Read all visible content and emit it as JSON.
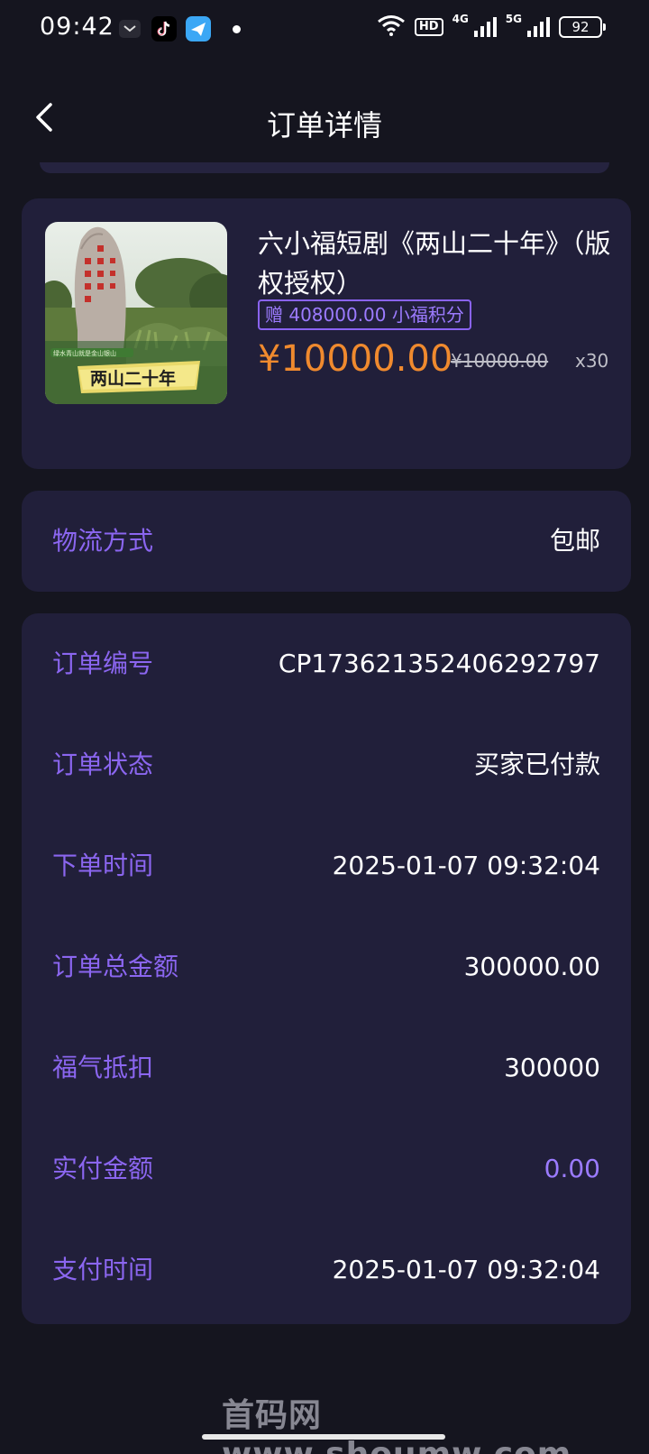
{
  "status_bar": {
    "time": "09:42",
    "hd_label": "HD",
    "net_4g": "4G",
    "net_5g": "5G",
    "battery": "92"
  },
  "header": {
    "title": "订单详情"
  },
  "product": {
    "title": "六小福短剧《两山二十年》（版权授权）",
    "gift": "赠 408000.00 小福积分",
    "price": "¥10000.00",
    "original_price": "¥10000.00",
    "quantity": "x30",
    "thumb_caption": "两山二十年",
    "thumb_engraving": "绿水青山就是金山银山"
  },
  "shipping": {
    "label": "物流方式",
    "value": "包邮"
  },
  "order_info": {
    "rows": [
      {
        "label": "订单编号",
        "value": "CP1736213524062927​97"
      },
      {
        "label": "订单状态",
        "value": "买家已付款"
      },
      {
        "label": "下单时间",
        "value": "2025-01-07 09:32:04"
      },
      {
        "label": "订单总金额",
        "value": "300000.00"
      },
      {
        "label": "福气抵扣",
        "value": "300000"
      },
      {
        "label": "实付金额",
        "value": "0.00"
      },
      {
        "label": "支付时间",
        "value": "2025-01-07 09:32:04"
      }
    ]
  },
  "watermark": "首码网www.shoumw.com",
  "colors": {
    "background": "#15151f",
    "card": "#211f3a",
    "label": "#8b66f0",
    "price": "#f08a2e",
    "accent_value": "#9b7bff"
  }
}
